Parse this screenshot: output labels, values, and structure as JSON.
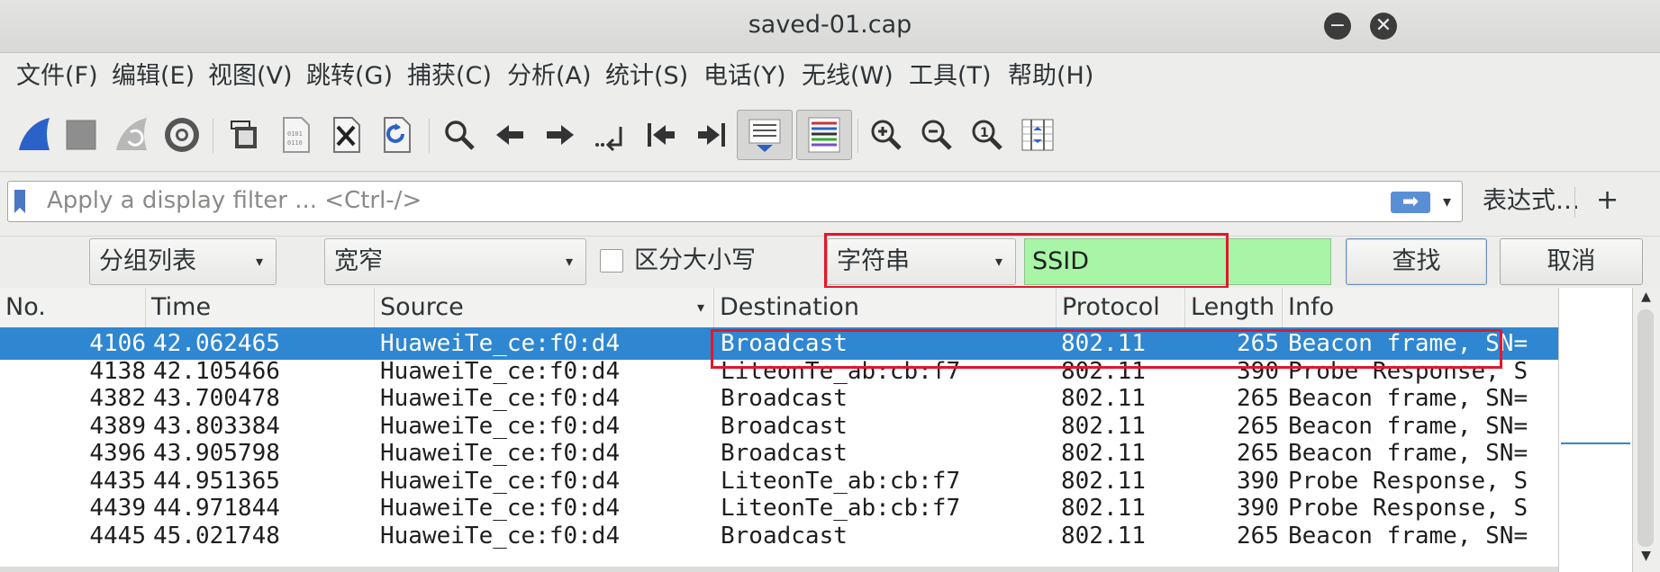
{
  "window": {
    "title": "saved-01.cap",
    "minimize_glyph": "−",
    "close_glyph": "✕"
  },
  "menu": [
    {
      "label": "文件(F)"
    },
    {
      "label": "编辑(E)"
    },
    {
      "label": "视图(V)"
    },
    {
      "label": "跳转(G)"
    },
    {
      "label": "捕获(C)"
    },
    {
      "label": "分析(A)"
    },
    {
      "label": "统计(S)"
    },
    {
      "label": "电话(Y)"
    },
    {
      "label": "无线(W)"
    },
    {
      "label": "工具(T)"
    },
    {
      "label": "帮助(H)"
    }
  ],
  "toolbar": {
    "icons": [
      "shark-fin-start-icon",
      "stop-capture-icon",
      "restart-capture-icon",
      "capture-options-gear-icon",
      "open-file-icon",
      "save-file-icon",
      "close-file-icon",
      "reload-file-icon",
      "find-packet-icon",
      "go-back-icon",
      "go-forward-icon",
      "go-to-packet-icon",
      "go-first-icon",
      "go-last-icon",
      "auto-scroll-icon",
      "colorize-icon",
      "zoom-in-icon",
      "zoom-out-icon",
      "zoom-normal-icon",
      "resize-columns-icon"
    ]
  },
  "filter": {
    "placeholder": "Apply a display filter ... <Ctrl-/>",
    "apply_glyph": "➡",
    "dropdown_glyph": "▾",
    "expression_label": "表达式…",
    "add_glyph": "+"
  },
  "find": {
    "search_in": "分组列表",
    "char_width": "宽窄",
    "case_label": "区分大小写",
    "search_type": "字符串",
    "query": "SSID",
    "find_label": "查找",
    "cancel_label": "取消",
    "combo_arrow": "▾",
    "case_sensitive": false
  },
  "packet_list": {
    "columns": [
      "No.",
      "Time",
      "Source",
      "Destination",
      "Protocol",
      "Length",
      "Info"
    ],
    "sort_glyph": "▾",
    "rows": [
      {
        "no": "4106",
        "time": "42.062465",
        "source": "HuaweiTe_ce:f0:d4",
        "destination": "Broadcast",
        "protocol": "802.11",
        "length": "265",
        "info": "Beacon frame, SN=",
        "selected": true
      },
      {
        "no": "4138",
        "time": "42.105466",
        "source": "HuaweiTe_ce:f0:d4",
        "destination": "LiteonTe_ab:cb:f7",
        "protocol": "802.11",
        "length": "390",
        "info": "Probe Response, S",
        "selected": false
      },
      {
        "no": "4382",
        "time": "43.700478",
        "source": "HuaweiTe_ce:f0:d4",
        "destination": "Broadcast",
        "protocol": "802.11",
        "length": "265",
        "info": "Beacon frame, SN=",
        "selected": false
      },
      {
        "no": "4389",
        "time": "43.803384",
        "source": "HuaweiTe_ce:f0:d4",
        "destination": "Broadcast",
        "protocol": "802.11",
        "length": "265",
        "info": "Beacon frame, SN=",
        "selected": false
      },
      {
        "no": "4396",
        "time": "43.905798",
        "source": "HuaweiTe_ce:f0:d4",
        "destination": "Broadcast",
        "protocol": "802.11",
        "length": "265",
        "info": "Beacon frame, SN=",
        "selected": false
      },
      {
        "no": "4435",
        "time": "44.951365",
        "source": "HuaweiTe_ce:f0:d4",
        "destination": "LiteonTe_ab:cb:f7",
        "protocol": "802.11",
        "length": "390",
        "info": "Probe Response, S",
        "selected": false
      },
      {
        "no": "4439",
        "time": "44.971844",
        "source": "HuaweiTe_ce:f0:d4",
        "destination": "LiteonTe_ab:cb:f7",
        "protocol": "802.11",
        "length": "390",
        "info": "Probe Response, S",
        "selected": false
      },
      {
        "no": "4445",
        "time": "45.021748",
        "source": "HuaweiTe_ce:f0:d4",
        "destination": "Broadcast",
        "protocol": "802.11",
        "length": "265",
        "info": "Beacon frame, SN=",
        "selected": false
      }
    ]
  },
  "scrollbar": {
    "up_glyph": "▲",
    "down_glyph": "▼"
  },
  "colors": {
    "selection": "#2f86d1",
    "find_match": "#a8f5a8",
    "annotation": "#e0182d"
  }
}
